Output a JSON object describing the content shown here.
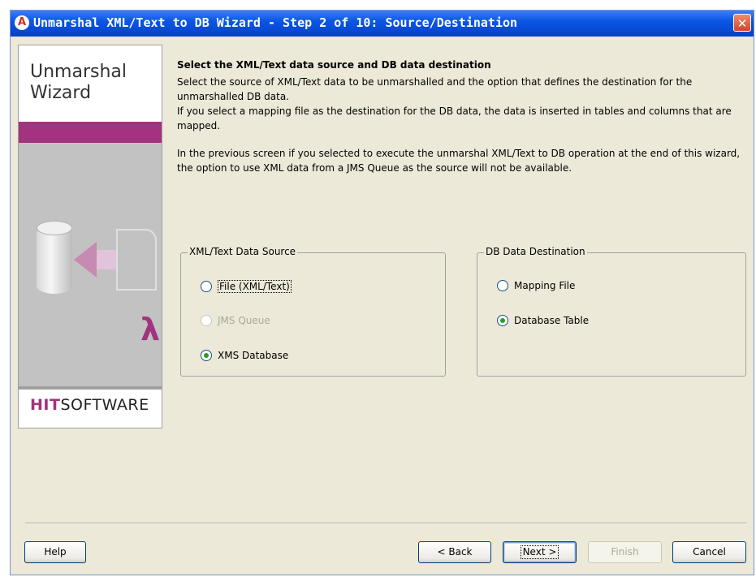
{
  "window": {
    "title": "Unmarshal XML/Text to DB Wizard - Step 2 of 10: Source/Destination",
    "title_icon": "A",
    "close_glyph": "✕"
  },
  "side_panel": {
    "wizard_title_line1": "Unmarshal",
    "wizard_title_line2": "Wizard",
    "logo_bold": "HIT",
    "logo_rest": "SOFTWARE"
  },
  "description": {
    "heading": "Select the XML/Text data source and DB data destination",
    "para1": "Select the source of XML/Text data to be unmarshalled  and the option that defines the destination for the unmarshalled DB data.",
    "para2": "If you select a mapping file as the destination for the DB data, the data is inserted in tables and columns that are mapped.",
    "para3": "In the previous screen if you selected to execute the unmarshal XML/Text to DB operation at the end of this wizard, the option to use XML data from a JMS Queue as the source will not be available."
  },
  "source_group": {
    "label": "XML/Text Data Source",
    "options": [
      {
        "label": "File (XML/Text)",
        "checked": false,
        "enabled": true,
        "focused": true
      },
      {
        "label": "JMS Queue",
        "checked": false,
        "enabled": false
      },
      {
        "label": "XMS Database",
        "checked": true,
        "enabled": true
      }
    ]
  },
  "dest_group": {
    "label": "DB Data Destination",
    "options": [
      {
        "label": "Mapping File",
        "checked": false,
        "enabled": true
      },
      {
        "label": "Database Table",
        "checked": true,
        "enabled": true
      }
    ]
  },
  "buttons": {
    "help": "Help",
    "back": "< Back",
    "next": "Next >",
    "finish": "Finish",
    "cancel": "Cancel"
  },
  "colors": {
    "accent": "#a1337f",
    "titlebar": "#0a57e3",
    "dialog_bg": "#ece9d8"
  }
}
